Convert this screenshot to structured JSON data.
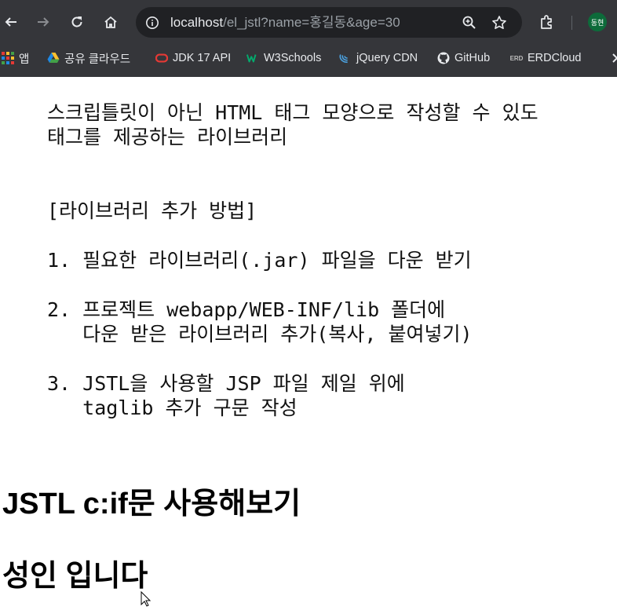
{
  "browser": {
    "url_host": "localhost",
    "url_path": "/el_jstl?name=홍길동&age=30",
    "profile_initials": "동현",
    "bookmarks": [
      {
        "label": "앱",
        "icon": "apps-grid-icon"
      },
      {
        "label": "공유 클라우드",
        "icon": "google-drive-icon"
      },
      {
        "label": "JDK 17 API",
        "icon": "oracle-icon"
      },
      {
        "label": "W3Schools",
        "icon": "w3schools-icon"
      },
      {
        "label": "jQuery CDN",
        "icon": "jquery-icon"
      },
      {
        "label": "GitHub",
        "icon": "github-icon"
      },
      {
        "label": "ERDCloud",
        "icon": "erd-icon"
      }
    ],
    "colors": {
      "frame": "#35363a",
      "omnibox": "#202124",
      "avatar": "#0d6b3a"
    }
  },
  "page": {
    "pre_block": {
      "intro_line1": "스크립틀릿이 아닌 HTML 태그 모양으로 작성할 수 있도",
      "intro_line2": "태그를 제공하는 라이브러리",
      "section_title": "[라이브러리 추가 방법]",
      "step1": "1. 필요한 라이브러리(.jar) 파일을 다운 받기",
      "step2_line1": "2. 프로젝트 webapp/WEB-INF/lib 폴더에",
      "step2_line2": "   다운 받은 라이브러리 추가(복사, 붙여넣기)",
      "step3_line1": "3. JSTL을 사용할 JSP 파일 제일 위에",
      "step3_line2": "   taglib 추가 구문 작성"
    },
    "heading1": "JSTL c:if문 사용해보기",
    "heading2": "성인 입니다"
  }
}
